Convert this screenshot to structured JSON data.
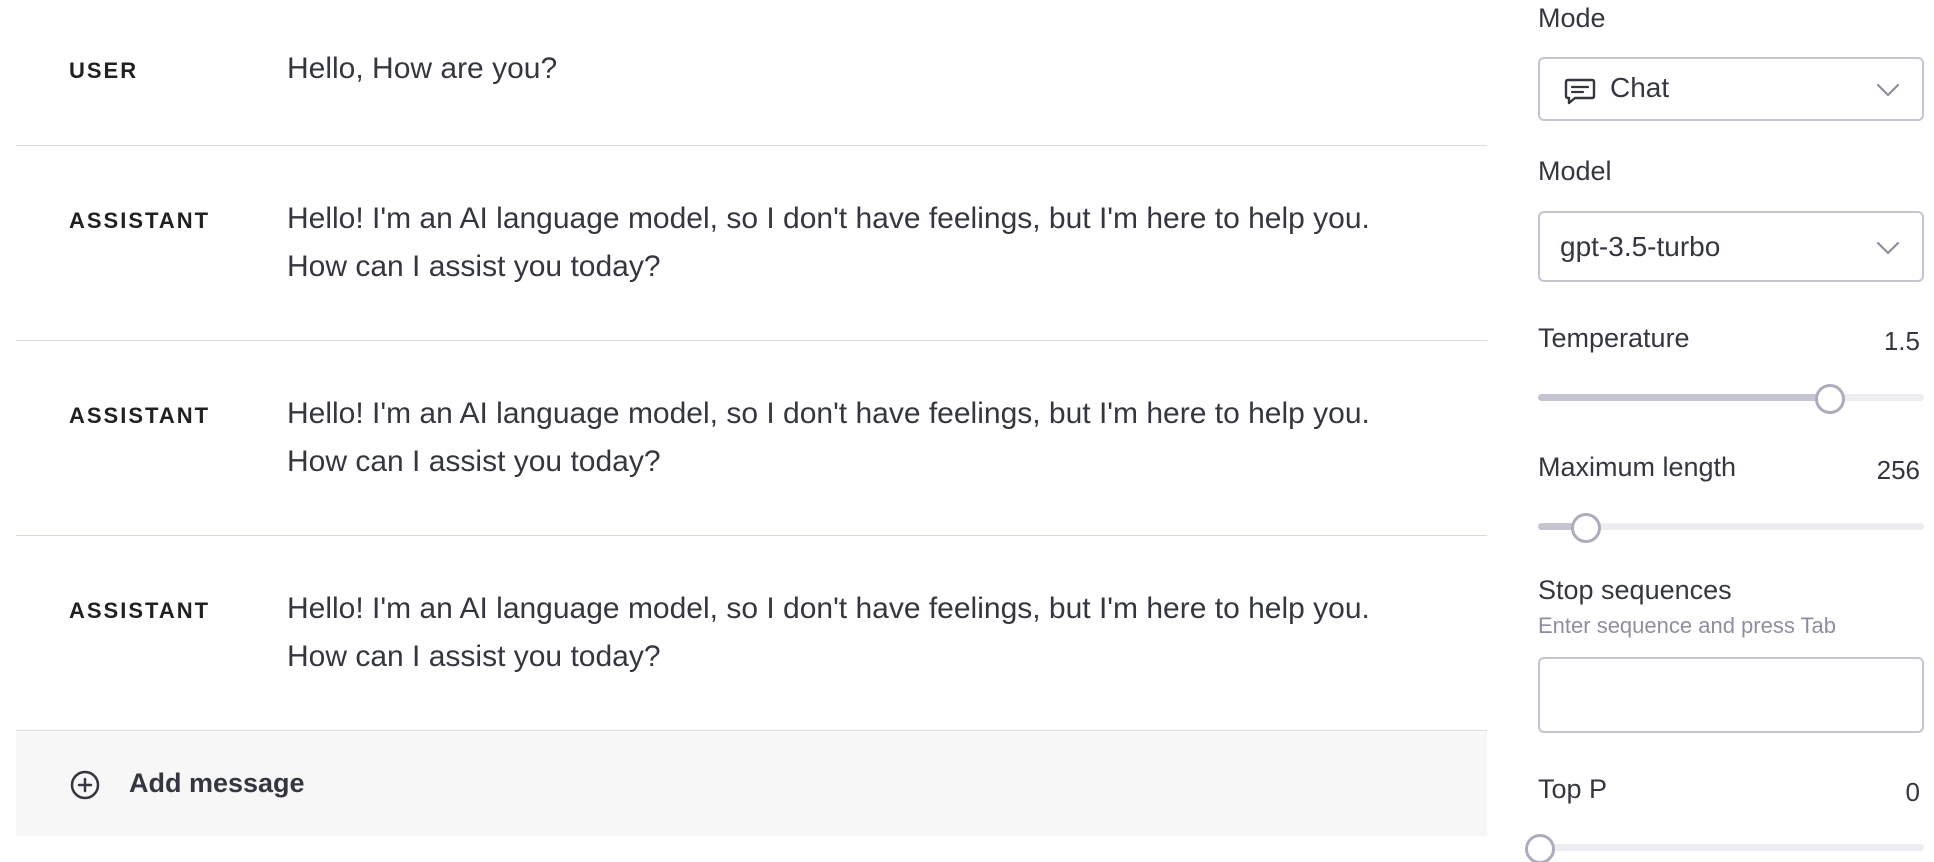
{
  "messages": [
    {
      "role": "USER",
      "content": "Hello, How are you?"
    },
    {
      "role": "ASSISTANT",
      "content": "Hello! I'm an AI language model, so I don't have feelings, but I'm here to help you. How can I assist you today?"
    },
    {
      "role": "ASSISTANT",
      "content": "Hello! I'm an AI language model, so I don't have feelings, but I'm here to help you. How can I assist you today?"
    },
    {
      "role": "ASSISTANT",
      "content": "Hello! I'm an AI language model, so I don't have feelings, but I'm here to help you. How can I assist you today?"
    }
  ],
  "add_message": {
    "label": "Add message",
    "icon": "plus-circle-icon"
  },
  "sidebar": {
    "mode": {
      "label": "Mode",
      "value": "Chat",
      "icon": "chat-bubble-icon"
    },
    "model": {
      "label": "Model",
      "value": "gpt-3.5-turbo"
    },
    "temperature": {
      "label": "Temperature",
      "value": "1.5",
      "fraction": 0.75
    },
    "max_length": {
      "label": "Maximum length",
      "value": "256",
      "fraction": 0.12
    },
    "stop_sequences": {
      "label": "Stop sequences",
      "hint": "Enter sequence and press Tab",
      "value": ""
    },
    "top_p": {
      "label": "Top P",
      "value": "0",
      "fraction": 0.0
    }
  },
  "colors": {
    "border": "#d9d9e3",
    "add_row_bg": "#f7f7f8",
    "track": "#ececf1",
    "track_fill": "#c5c5d2",
    "thumb_border": "#acacbe"
  }
}
